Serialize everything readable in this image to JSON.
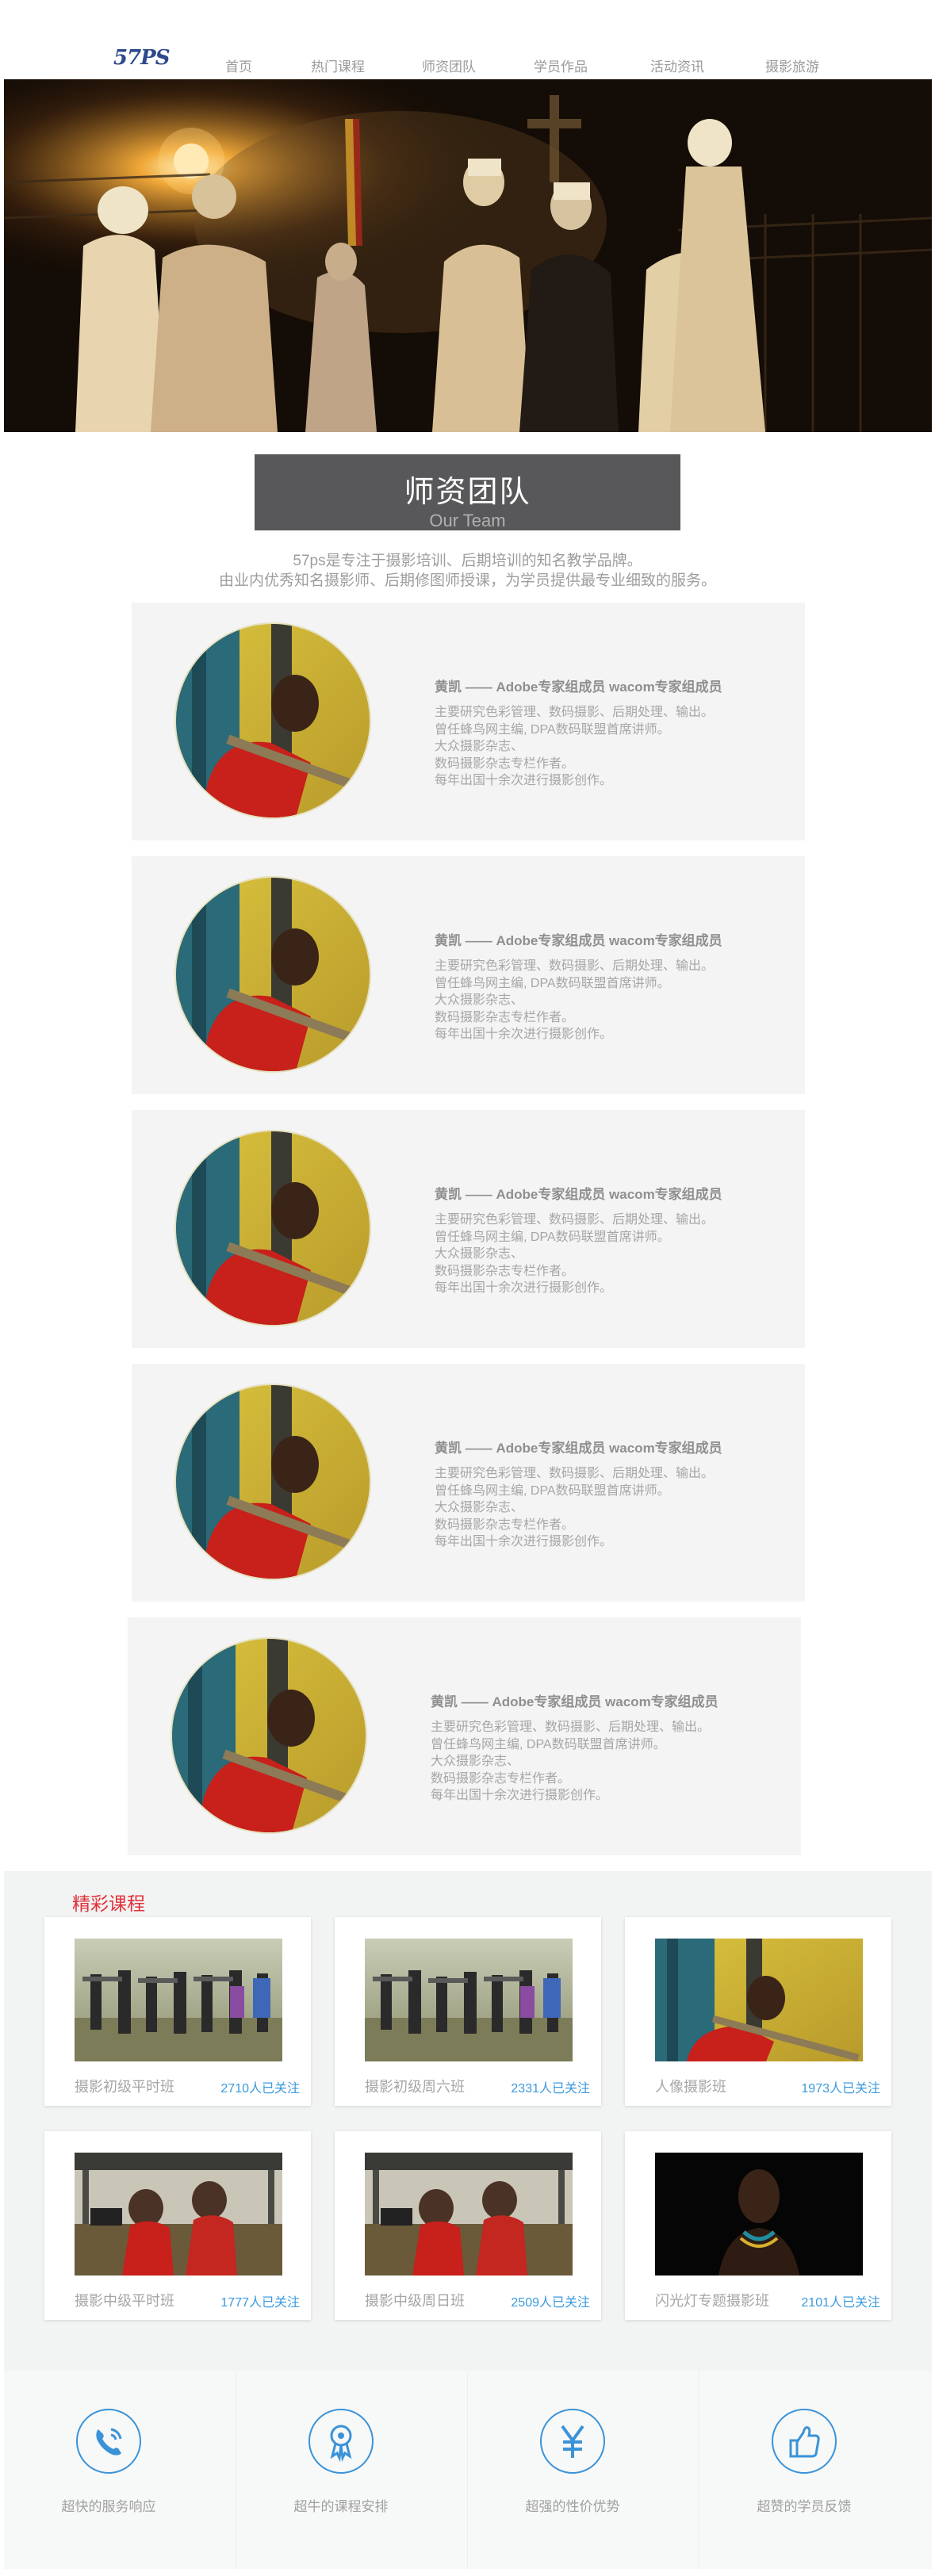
{
  "header": {
    "logo": "57PS",
    "nav": [
      "首页",
      "热门课程",
      "师资团队",
      "学员作品",
      "活动资讯",
      "摄影旅游"
    ]
  },
  "team": {
    "title_cn": "师资团队",
    "title_en": "Our Team",
    "intro": [
      "57ps是专注于摄影培训、后期培训的知名教学品牌。",
      "由业内优秀知名摄影师、后期修图师授课，为学员提供最专业细致的服务。"
    ],
    "teachers": [
      {
        "name": "黄凯 —— Adobe专家组成员 wacom专家组成员",
        "desc": [
          "主要研究色彩管理、数码摄影、后期处理、输出。",
          "曾任蜂鸟网主编, DPA数码联盟首席讲师。",
          "大众摄影杂志、",
          "数码摄影杂志专栏作者。",
          "每年出国十余次进行摄影创作。"
        ]
      },
      {
        "name": "黄凯 —— Adobe专家组成员 wacom专家组成员",
        "desc": [
          "主要研究色彩管理、数码摄影、后期处理、输出。",
          "曾任蜂鸟网主编, DPA数码联盟首席讲师。",
          "大众摄影杂志、",
          "数码摄影杂志专栏作者。",
          "每年出国十余次进行摄影创作。"
        ]
      },
      {
        "name": "黄凯 —— Adobe专家组成员 wacom专家组成员",
        "desc": [
          "主要研究色彩管理、数码摄影、后期处理、输出。",
          "曾任蜂鸟网主编, DPA数码联盟首席讲师。",
          "大众摄影杂志、",
          "数码摄影杂志专栏作者。",
          "每年出国十余次进行摄影创作。"
        ]
      },
      {
        "name": "黄凯 —— Adobe专家组成员 wacom专家组成员",
        "desc": [
          "主要研究色彩管理、数码摄影、后期处理、输出。",
          "曾任蜂鸟网主编, DPA数码联盟首席讲师。",
          "大众摄影杂志、",
          "数码摄影杂志专栏作者。",
          "每年出国十余次进行摄影创作。"
        ]
      },
      {
        "name": "黄凯 —— Adobe专家组成员 wacom专家组成员",
        "desc": [
          "主要研究色彩管理、数码摄影、后期处理、输出。",
          "曾任蜂鸟网主编, DPA数码联盟首席讲师。",
          "大众摄影杂志、",
          "数码摄影杂志专栏作者。",
          "每年出国十余次进行摄影创作。"
        ]
      }
    ]
  },
  "courses": {
    "title": "精彩课程",
    "items": [
      {
        "name": "摄影初级平时班",
        "follow": "2710人已关注",
        "thumb": "photographers"
      },
      {
        "name": "摄影初级周六班",
        "follow": "2331人已关注",
        "thumb": "photographers"
      },
      {
        "name": "人像摄影班",
        "follow": "1973人已关注",
        "thumb": "portrait-door"
      },
      {
        "name": "摄影中级平时班",
        "follow": "1777人已关注",
        "thumb": "safari"
      },
      {
        "name": "摄影中级周日班",
        "follow": "2509人已关注",
        "thumb": "safari"
      },
      {
        "name": "闪光灯专题摄影班",
        "follow": "2101人已关注",
        "thumb": "portrait-dark"
      }
    ]
  },
  "features": [
    {
      "label": "超快的服务响应",
      "icon": "phone-icon"
    },
    {
      "label": "超牛的课程安排",
      "icon": "medal-icon"
    },
    {
      "label": "超强的性价优势",
      "icon": "yen-icon"
    },
    {
      "label": "超赞的学员反馈",
      "icon": "thumbs-up-icon"
    }
  ],
  "colors": {
    "accent": "#3a93d8",
    "title_red": "#e0303a",
    "title_bar": "#58585a"
  }
}
